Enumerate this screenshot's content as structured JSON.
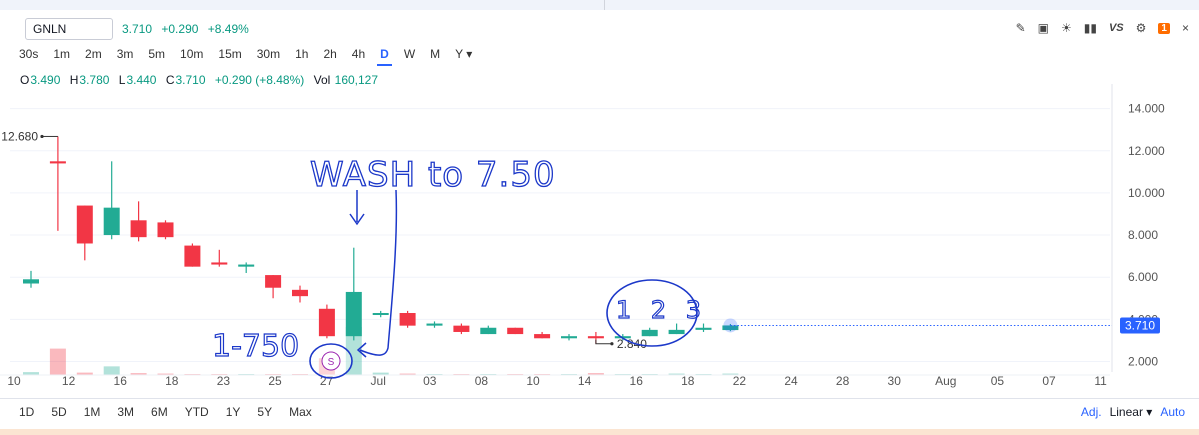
{
  "header": {
    "symbol": "GNLN",
    "last": "3.710",
    "change": "+0.290",
    "change_pct": "+8.49%",
    "tools": [
      "pencil-icon",
      "chart-icon",
      "bulb-icon",
      "candles-icon",
      "VS",
      "settings-icon",
      "1",
      "×"
    ]
  },
  "intervals": [
    "30s",
    "1m",
    "2m",
    "3m",
    "5m",
    "10m",
    "15m",
    "30m",
    "1h",
    "2h",
    "4h",
    "D",
    "W",
    "M",
    "Y ▾"
  ],
  "active_interval": "D",
  "ohlc": {
    "o_label": "O",
    "o": "3.490",
    "h_label": "H",
    "h": "3.780",
    "l_label": "L",
    "l": "3.440",
    "c_label": "C",
    "c": "3.710",
    "chg": "+0.290 (+8.48%)",
    "vol_label": "Vol",
    "vol": "160,127"
  },
  "ranges": [
    "1D",
    "5D",
    "1M",
    "3M",
    "6M",
    "YTD",
    "1Y",
    "5Y",
    "Max"
  ],
  "scale": {
    "adj": "Adj.",
    "mode": "Linear ▾",
    "auto": "Auto"
  },
  "colors": {
    "up": "#22ab94",
    "down": "#f23645",
    "accent": "#2962ff",
    "ink": "#1c38c9"
  },
  "chart_data": {
    "type": "candlestick",
    "y_ticks": [
      "14.000",
      "12.000",
      "10.000",
      "8.000",
      "6.000",
      "4.000",
      "2.000"
    ],
    "ylim": [
      1.5,
      14.6
    ],
    "x_ticks": [
      "10",
      "12",
      "16",
      "18",
      "23",
      "25",
      "27",
      "Jul",
      "03",
      "08",
      "10",
      "14",
      "16",
      "18",
      "22",
      "24",
      "28",
      "30",
      "Aug",
      "05",
      "07",
      "11"
    ],
    "last_price_label": "3.710",
    "high_marker": "12.680",
    "high_marker_value": 12.68,
    "low_marker": "2.840",
    "low_marker_value": 2.84,
    "candles": [
      {
        "o": 5.7,
        "h": 6.3,
        "l": 5.5,
        "c": 5.9
      },
      {
        "o": 11.5,
        "h": 12.68,
        "l": 8.2,
        "c": 11.4
      },
      {
        "o": 9.4,
        "h": 9.4,
        "l": 6.8,
        "c": 7.6
      },
      {
        "o": 8.0,
        "h": 11.5,
        "l": 7.8,
        "c": 9.3
      },
      {
        "o": 8.7,
        "h": 9.6,
        "l": 7.7,
        "c": 7.9
      },
      {
        "o": 8.6,
        "h": 8.7,
        "l": 7.8,
        "c": 7.9
      },
      {
        "o": 7.5,
        "h": 7.6,
        "l": 6.5,
        "c": 6.5
      },
      {
        "o": 6.7,
        "h": 7.3,
        "l": 6.5,
        "c": 6.6
      },
      {
        "o": 6.5,
        "h": 6.7,
        "l": 6.2,
        "c": 6.6
      },
      {
        "o": 6.1,
        "h": 6.1,
        "l": 5.0,
        "c": 5.5
      },
      {
        "o": 5.4,
        "h": 5.6,
        "l": 4.8,
        "c": 5.1
      },
      {
        "o": 4.5,
        "h": 4.7,
        "l": 3.1,
        "c": 3.2
      },
      {
        "o": 3.2,
        "h": 7.4,
        "l": 3.0,
        "c": 5.3
      },
      {
        "o": 4.3,
        "h": 4.4,
        "l": 4.1,
        "c": 4.3
      },
      {
        "o": 4.3,
        "h": 4.4,
        "l": 3.6,
        "c": 3.7
      },
      {
        "o": 3.7,
        "h": 3.9,
        "l": 3.6,
        "c": 3.8
      },
      {
        "o": 3.7,
        "h": 3.8,
        "l": 3.3,
        "c": 3.4
      },
      {
        "o": 3.3,
        "h": 3.7,
        "l": 3.3,
        "c": 3.6
      },
      {
        "o": 3.6,
        "h": 3.6,
        "l": 3.3,
        "c": 3.3
      },
      {
        "o": 3.3,
        "h": 3.4,
        "l": 3.1,
        "c": 3.1
      },
      {
        "o": 3.1,
        "h": 3.3,
        "l": 3.0,
        "c": 3.2
      },
      {
        "o": 3.2,
        "h": 3.4,
        "l": 2.84,
        "c": 3.1
      },
      {
        "o": 3.1,
        "h": 3.3,
        "l": 3.0,
        "c": 3.2
      },
      {
        "o": 3.2,
        "h": 3.6,
        "l": 3.2,
        "c": 3.5
      },
      {
        "o": 3.3,
        "h": 3.8,
        "l": 3.3,
        "c": 3.5
      },
      {
        "o": 3.5,
        "h": 3.8,
        "l": 3.4,
        "c": 3.6
      },
      {
        "o": 3.49,
        "h": 3.78,
        "l": 3.44,
        "c": 3.71
      }
    ],
    "volumes": [
      0.06,
      0.55,
      0.05,
      0.18,
      0.04,
      0.03,
      0.02,
      0.02,
      0.02,
      0.02,
      0.02,
      0.35,
      1.0,
      0.05,
      0.03,
      0.02,
      0.02,
      0.02,
      0.02,
      0.02,
      0.02,
      0.04,
      0.02,
      0.02,
      0.03,
      0.02,
      0.03
    ],
    "annotations": [
      {
        "text": "WASH to 7.50"
      },
      {
        "text": "1-750"
      },
      {
        "text": "1 2 3"
      },
      {
        "text": "S"
      }
    ]
  }
}
